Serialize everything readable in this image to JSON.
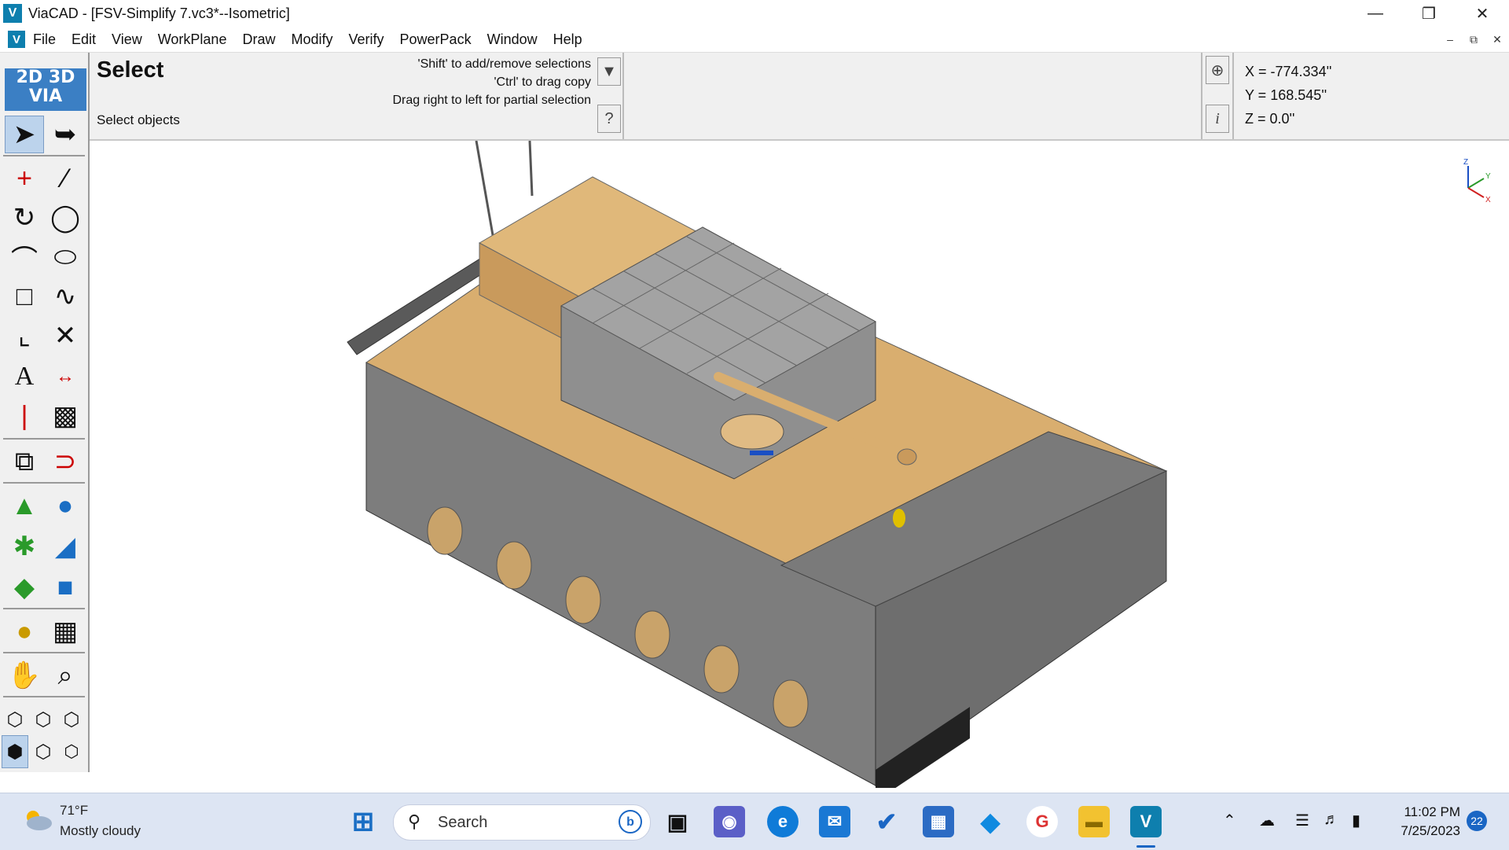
{
  "window": {
    "app_icon": "viacad-logo-icon",
    "title": "ViaCAD - [FSV-Simplify 7.vc3*--Isometric]",
    "controls": [
      "minimize-icon",
      "restore-icon",
      "close-icon"
    ]
  },
  "menu": {
    "items": [
      "File",
      "Edit",
      "View",
      "WorkPlane",
      "Draw",
      "Modify",
      "Verify",
      "PowerPack",
      "Window",
      "Help"
    ]
  },
  "prompt": {
    "title": "Select",
    "subtitle": "Select objects",
    "hints": [
      "'Shift' to add/remove selections",
      "'Ctrl' to drag copy",
      "Drag right to left for partial selection"
    ],
    "help_label": "?",
    "info_label": "i"
  },
  "coords": {
    "x": "X = -774.334''",
    "y": "Y = 168.545''",
    "z": "Z = 0.0''"
  },
  "toolbar": {
    "logo_line1": "2D 3D",
    "logo_line2": "VIA",
    "tools": [
      "select-arrow-icon",
      "select-partial-icon",
      "point-icon",
      "line-icon",
      "arc-icon",
      "circle-icon",
      "curve-icon",
      "ellipse-icon",
      "rectangle-icon",
      "spline-icon",
      "fillet-icon",
      "trim-icon",
      "text-icon",
      "dimension-icon",
      "centerline-icon",
      "hatch-icon",
      "transform-icon",
      "magnet-icon",
      "extrude-icon",
      "sphere-icon",
      "revolve-icon",
      "shell-icon",
      "loft-icon",
      "box-icon",
      "render-icon",
      "views-icon",
      "pan-icon",
      "zoom-icon"
    ]
  },
  "viewport": {
    "axis_triad": [
      "Z",
      "Y",
      "X"
    ],
    "model": "tank-model"
  },
  "taskbar": {
    "weather_temp": "71°F",
    "weather_desc": "Mostly cloudy",
    "search_label": "Search",
    "time": "11:02 PM",
    "date": "7/25/2023",
    "notifications": "22",
    "pinned": [
      "windows-start-icon",
      "task-view-icon",
      "teams-icon",
      "edge-icon",
      "mail-icon",
      "todo-icon",
      "store-icon",
      "app-icon",
      "google-icon",
      "file-explorer-icon",
      "viacad-taskbar-icon"
    ]
  },
  "colors": {
    "hull": "#7d7d7d",
    "deck": "#d9ae6f",
    "accent": "#1a66c4"
  }
}
